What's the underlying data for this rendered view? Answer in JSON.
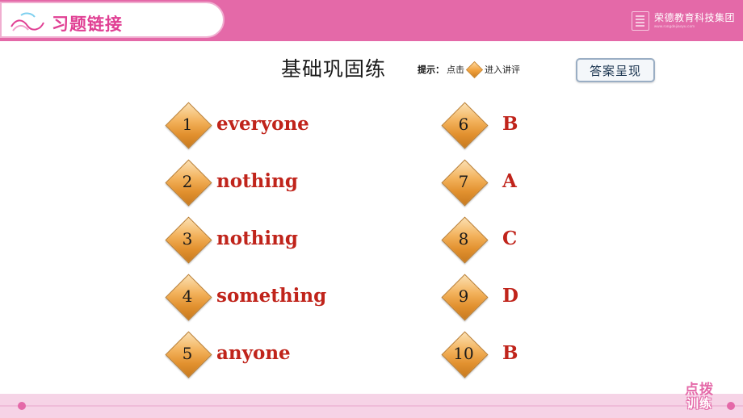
{
  "header": {
    "title": "习题链接",
    "brand_cn": "荣德教育科技集团",
    "brand_en": "www.rongdejiaoyu.com",
    "brand_icon": "book-icon"
  },
  "headline": "基础巩固练",
  "hint": {
    "label": "提示：",
    "before": "点击",
    "after": "进入讲评",
    "diamond_icon": "diamond-icon"
  },
  "answer_button": "答案呈现",
  "columns": {
    "left": [
      {
        "num": "1",
        "text": "everyone"
      },
      {
        "num": "2",
        "text": "nothing"
      },
      {
        "num": "3",
        "text": "nothing"
      },
      {
        "num": "4",
        "text": "something"
      },
      {
        "num": "5",
        "text": "anyone"
      }
    ],
    "right": [
      {
        "num": "6",
        "text": "B"
      },
      {
        "num": "7",
        "text": "A"
      },
      {
        "num": "8",
        "text": "C"
      },
      {
        "num": "9",
        "text": "D"
      },
      {
        "num": "10",
        "text": "B"
      }
    ]
  },
  "footer": {
    "logo_line1": "点拨",
    "logo_line2": "训练"
  },
  "colors": {
    "header_pink": "#e469a8",
    "title_pink": "#e03f93",
    "answer_red": "#c0241b",
    "diamond_gold": "#f0a03c",
    "footer_pink": "#f6d3e6"
  }
}
